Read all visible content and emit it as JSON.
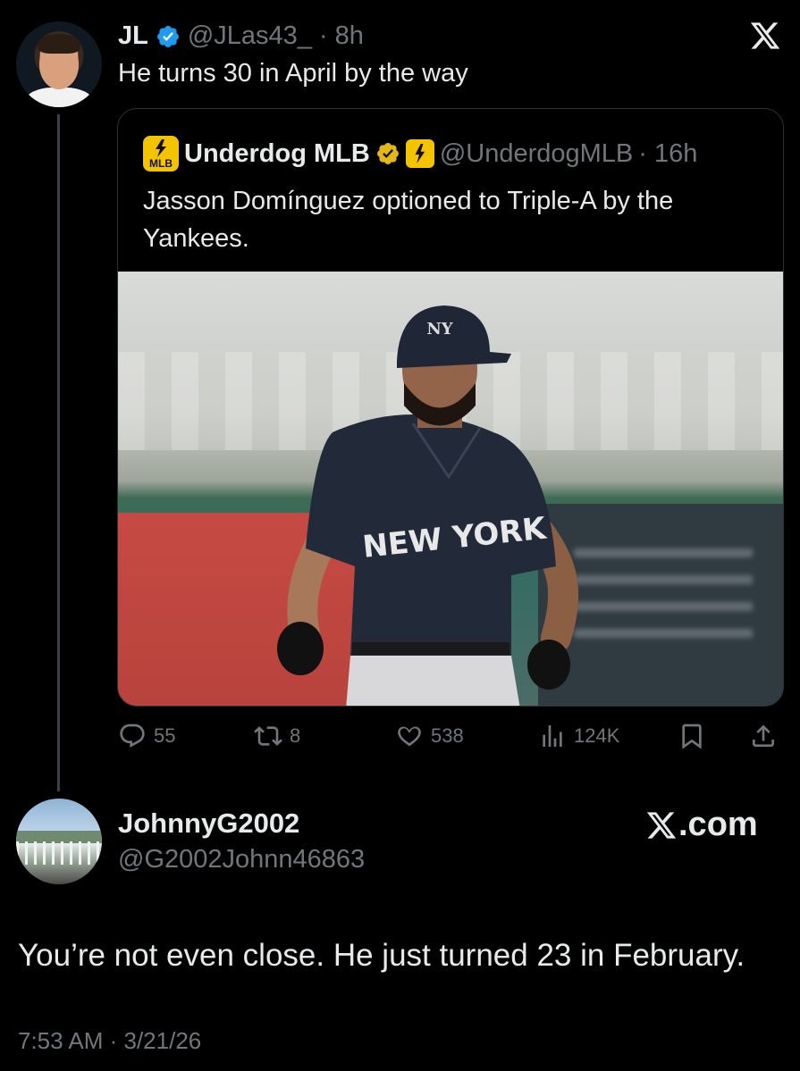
{
  "tweet": {
    "author_name": "JL",
    "author_handle": "@JLas43_",
    "time_ago": "· 8h",
    "text": "He turns 30 in April by the way"
  },
  "quote": {
    "logo_text": "MLB",
    "author_name": "Underdog MLB",
    "author_handle": "@UnderdogMLB",
    "time_ago": "· 16h",
    "text": "Jasson Domínguez optioned to Triple-A by the Yankees.",
    "jersey_text": "NEW YORK"
  },
  "actions": {
    "replies": "55",
    "reposts": "8",
    "likes": "538",
    "views": "124K"
  },
  "reply": {
    "author_name": "JohnnyG2002",
    "author_handle": "@G2002Johnn46863",
    "brand_text": ".com",
    "text": "You’re not even close. He just turned 23 in February.",
    "timestamp": "7:53 AM · 3/21/26"
  },
  "colors": {
    "background": "#000000",
    "text": "#e7e9ea",
    "muted": "#71767b",
    "verified_blue": "#1d9bf0",
    "verified_gold": "#e2b719",
    "underdog_yellow": "#f5c400",
    "border": "#2f3336"
  },
  "icons": [
    "verified-badge-icon",
    "x-logo-icon",
    "reply-icon",
    "repost-icon",
    "like-icon",
    "views-icon",
    "bookmark-icon",
    "share-icon"
  ]
}
